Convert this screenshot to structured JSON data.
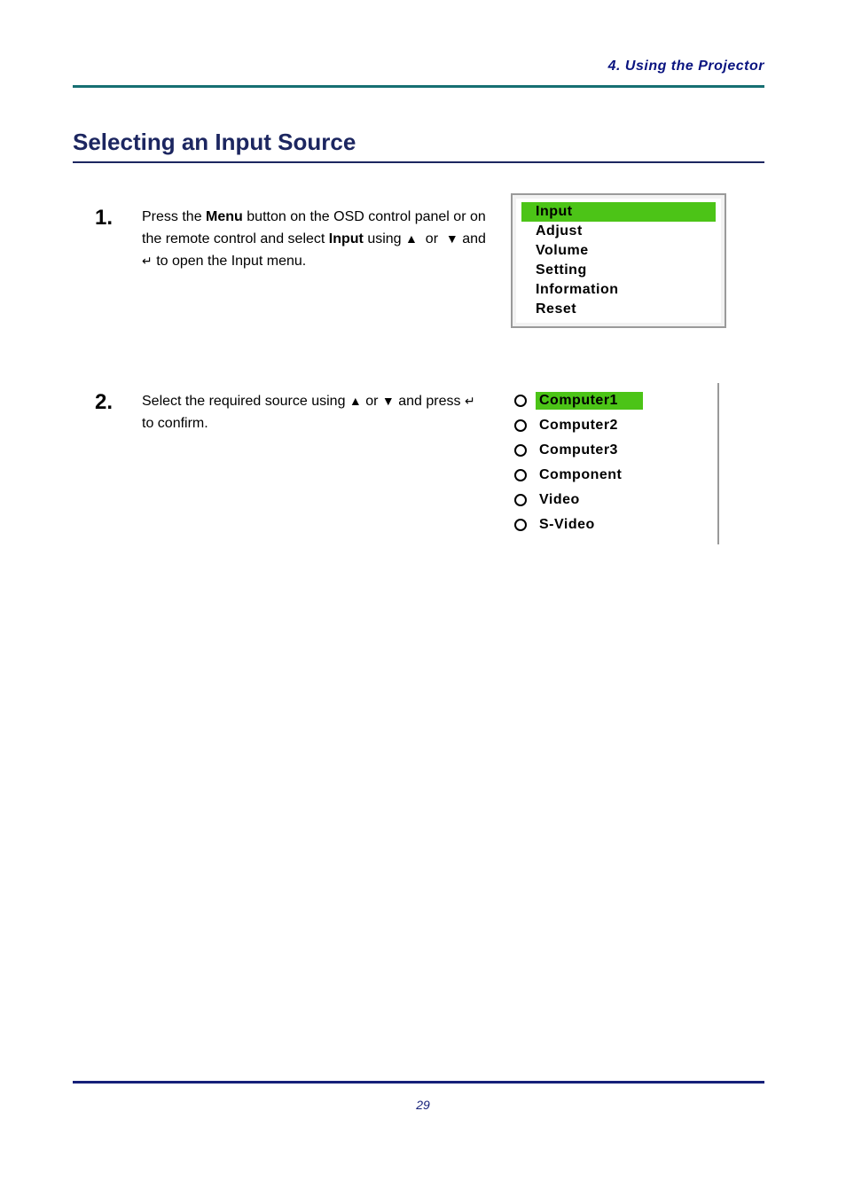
{
  "header": {
    "right_text": "4. Using the Projector"
  },
  "section": {
    "title": "Selecting an Input Source"
  },
  "steps": [
    {
      "number": "1.",
      "text_before": "Press the ",
      "menu_key": "Menu",
      "text_mid1": " button on the OSD control panel or on the remote control and select ",
      "input_key": "Input",
      "text_mid2": " using ",
      "text_after": " and ",
      "text_end": " to open the Input menu."
    },
    {
      "number": "2.",
      "text_before": "Select the required source using ",
      "text_mid": " or ",
      "text_after": " and press ",
      "text_end": " to confirm."
    }
  ],
  "icons": {
    "up": "▲",
    "down": "▼",
    "enter": "↵"
  },
  "main_menu": {
    "items": [
      "Input",
      "Adjust",
      "Volume",
      "Setting",
      "Information",
      "Reset"
    ],
    "selected_index": 0
  },
  "input_menu": {
    "items": [
      "Computer1",
      "Computer2",
      "Computer3",
      "Component",
      "Video",
      "S-Video"
    ],
    "selected_index": 0
  },
  "footer": {
    "page_number": "29"
  },
  "colors": {
    "highlight_green": "#4cc417",
    "header_rule": "#166f72",
    "footer_rule": "#152079",
    "title_color": "#1c2660"
  }
}
